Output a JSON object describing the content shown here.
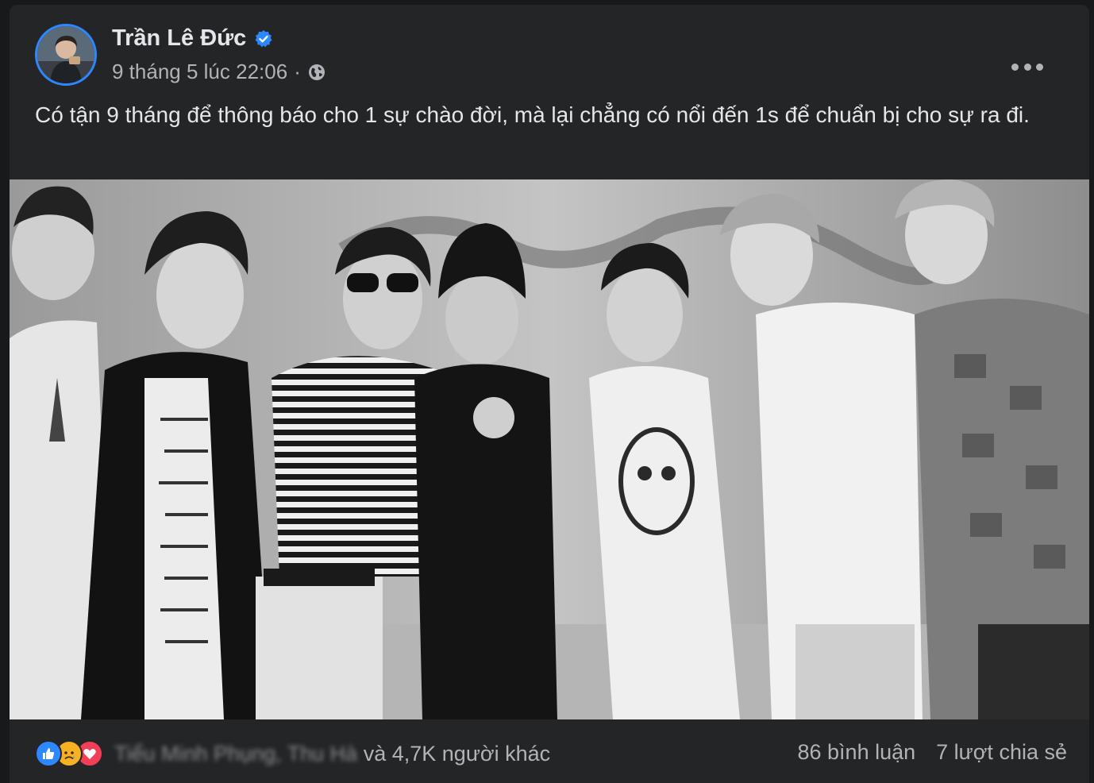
{
  "post": {
    "author": "Trần Lê Đức",
    "verified": true,
    "timestamp": "9 tháng 5 lúc 22:06",
    "separator": "·",
    "privacy_icon": "globe-icon",
    "menu_icon": "more-dots-icon",
    "text": "Có tận 9 tháng để thông báo cho 1 sự chào đời, mà lại chẳng có nổi đến 1s để chuẩn bị cho sự ra đi.",
    "photo_icon": "group-photo"
  },
  "footer": {
    "reactions": [
      "like-icon",
      "sad-icon",
      "love-icon"
    ],
    "names_blurred": "Tiểu Minh Phụng, Thu Hà",
    "and_text": "và",
    "others_text": "4,7K người khác",
    "comments": "86 bình luận",
    "shares": "7 lượt chia sẻ"
  },
  "colors": {
    "background": "#18191a",
    "card": "#242526",
    "text_primary": "#e4e6eb",
    "text_secondary": "#b0b3b8",
    "accent": "#2d88ff",
    "like": "#2d88ff",
    "sad": "#f7b125",
    "love": "#f33e58"
  }
}
